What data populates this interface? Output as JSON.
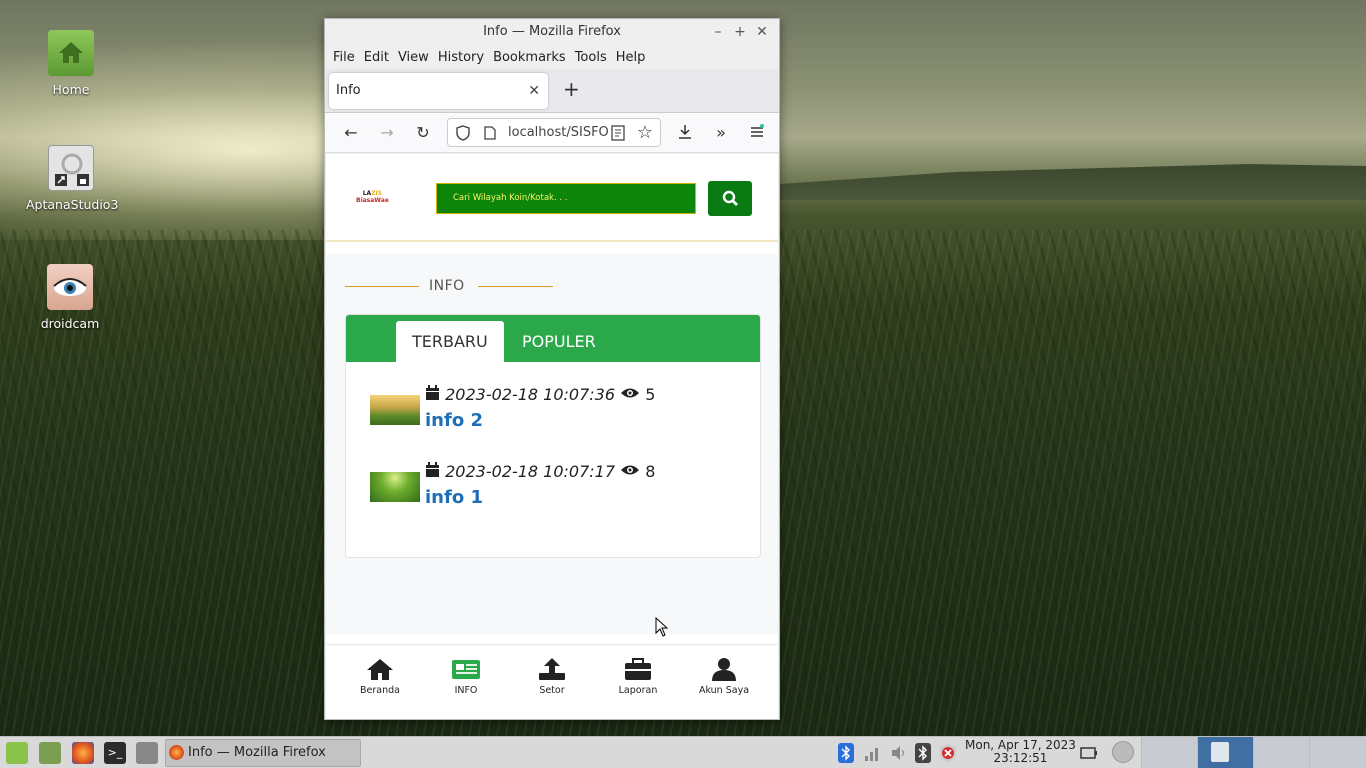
{
  "desktop": {
    "icons": [
      {
        "label": "Home"
      },
      {
        "label": "AptanaStudio3"
      },
      {
        "label": "droidcam"
      }
    ]
  },
  "window": {
    "title": "Info — Mozilla Firefox"
  },
  "menubar": {
    "items": [
      "File",
      "Edit",
      "View",
      "History",
      "Bookmarks",
      "Tools",
      "Help"
    ]
  },
  "browser": {
    "tab_title": "Info",
    "url": "localhost/SISFO"
  },
  "site": {
    "logo_line1_a": "LA",
    "logo_line1_b": "ZIS",
    "logo_line2": "BiasaWae",
    "search_placeholder": "Cari Wilayah Koin/Kotak. . .",
    "heading": "INFO",
    "tabs": [
      "TERBARU",
      "POPULER"
    ],
    "items": [
      {
        "date": "2023-02-18 10:07:36",
        "views": "5",
        "title": "info 2"
      },
      {
        "date": "2023-02-18 10:07:17",
        "views": "8",
        "title": "info 1"
      }
    ],
    "nav": [
      "Beranda",
      "INFO",
      "Setor",
      "Laporan",
      "Akun Saya"
    ],
    "colors": {
      "primary_green": "#2aa84a",
      "active_nav": "#2aa84a",
      "link": "#1e6fb8"
    }
  },
  "taskbar": {
    "active_window": "Info — Mozilla Firefox",
    "clock_date": "Mon, Apr 17, 2023",
    "clock_time": "23:12:51"
  }
}
